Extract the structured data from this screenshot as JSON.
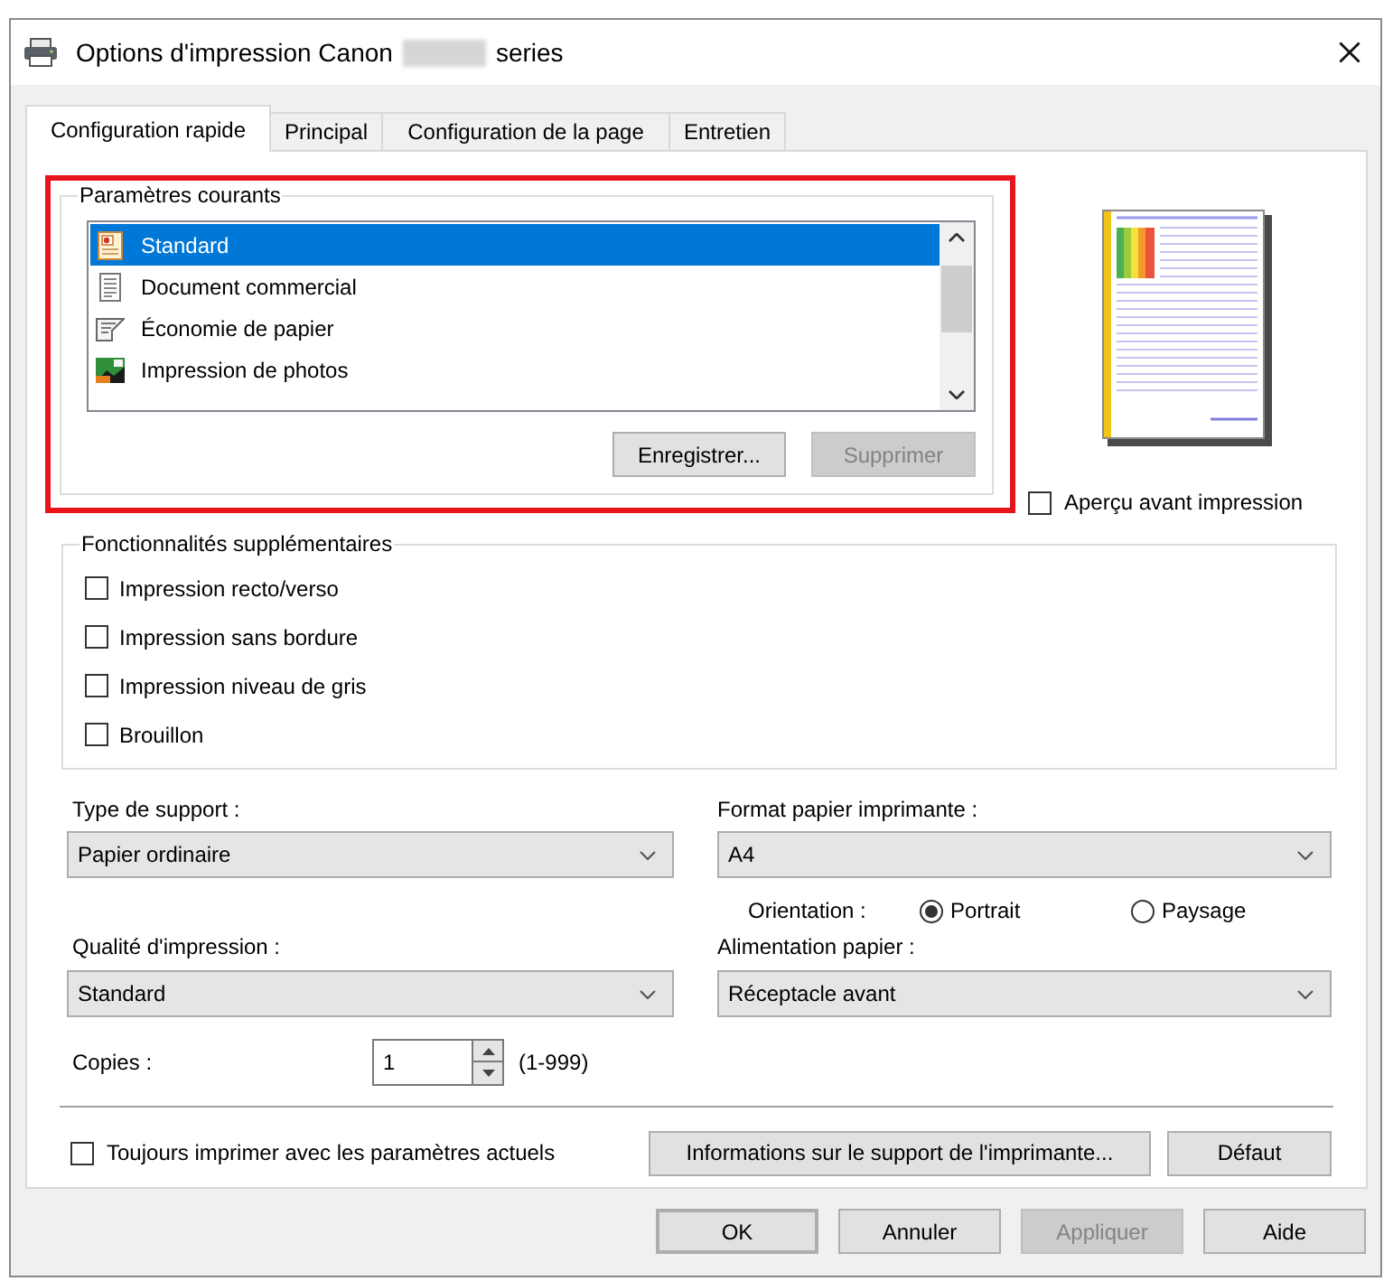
{
  "window": {
    "title": "Options d'impression Canon",
    "title_suffix": "series"
  },
  "tabs": [
    {
      "label": "Configuration rapide",
      "selected": true
    },
    {
      "label": "Principal",
      "selected": false
    },
    {
      "label": "Configuration de la page",
      "selected": false
    },
    {
      "label": "Entretien",
      "selected": false
    }
  ],
  "current_settings": {
    "title": "Paramètres courants",
    "items": [
      {
        "label": "Standard",
        "kind": "standard",
        "selected": true
      },
      {
        "label": "Document commercial",
        "kind": "document",
        "selected": false
      },
      {
        "label": "Économie de papier",
        "kind": "paper_saving",
        "selected": false
      },
      {
        "label": "Impression de photos",
        "kind": "photo",
        "selected": false
      }
    ],
    "buttons": [
      {
        "label": "Enregistrer...",
        "disabled": false
      },
      {
        "label": "Supprimer",
        "disabled": true
      }
    ]
  },
  "preview": {
    "label": "Aperçu avant impression",
    "checked": false
  },
  "features": {
    "title": "Fonctionnalités supplémentaires",
    "options": [
      {
        "label": "Impression recto/verso",
        "checked": false
      },
      {
        "label": "Impression sans bordure",
        "checked": false
      },
      {
        "label": "Impression niveau de gris",
        "checked": false
      },
      {
        "label": "Brouillon",
        "checked": false
      }
    ]
  },
  "media_type": {
    "label": "Type de support :",
    "value": "Papier ordinaire"
  },
  "paper_size": {
    "label": "Format papier imprimante :",
    "value": "A4"
  },
  "orientation": {
    "label": "Orientation :",
    "options": [
      {
        "label": "Portrait",
        "selected": true
      },
      {
        "label": "Paysage",
        "selected": false
      }
    ]
  },
  "print_quality": {
    "label": "Qualité d'impression :",
    "value": "Standard"
  },
  "paper_source": {
    "label": "Alimentation papier :",
    "value": "Réceptacle avant"
  },
  "copies": {
    "label": "Copies :",
    "value": "1",
    "range": "(1-999)"
  },
  "always_print": {
    "label": "Toujours imprimer avec les paramètres actuels",
    "checked": false
  },
  "panel_buttons": [
    {
      "label": "Informations sur le support de l'imprimante...",
      "disabled": false
    },
    {
      "label": "Défaut",
      "disabled": false
    }
  ],
  "dialog_buttons": [
    {
      "label": "OK",
      "default": true,
      "disabled": false
    },
    {
      "label": "Annuler",
      "default": false,
      "disabled": false
    },
    {
      "label": "Appliquer",
      "default": false,
      "disabled": true
    },
    {
      "label": "Aide",
      "default": false,
      "disabled": false
    }
  ]
}
